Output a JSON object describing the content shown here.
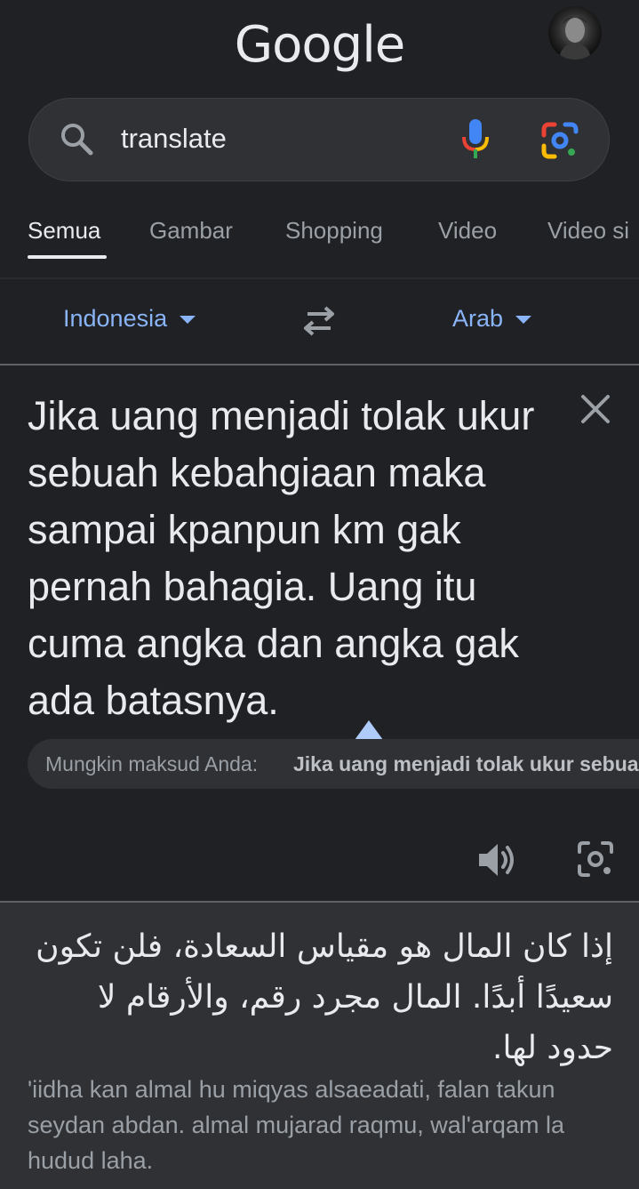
{
  "header": {
    "logo": "Google"
  },
  "search": {
    "query": "translate"
  },
  "tabs": [
    "Semua",
    "Gambar",
    "Shopping",
    "Video",
    "Video si"
  ],
  "translator": {
    "source_lang": "Indonesia",
    "target_lang": "Arab",
    "source_text": "Jika uang menjadi tolak ukur sebuah kebahgiaan maka sampai kpanpun km gak pernah bahagia. Uang itu cuma angka dan angka gak ada batasnya.",
    "did_you_mean_prefix": "Mungkin maksud Anda:",
    "did_you_mean_suggestion": "Jika uang menjadi tolak ukur sebuah",
    "output_text": "إذا كان المال هو مقياس السعادة، فلن تكون سعيدًا أبدًا. المال مجرد رقم، والأرقام لا حدود لها.",
    "transliteration": "'iidha kan almal hu miqyas alsaeadati, falan takun seydan abdan. almal mujarad raqmu, wal'arqam la hudud laha."
  },
  "colors": {
    "background": "#202124",
    "accent": "#8ab4f8",
    "output_bg": "#303134"
  }
}
